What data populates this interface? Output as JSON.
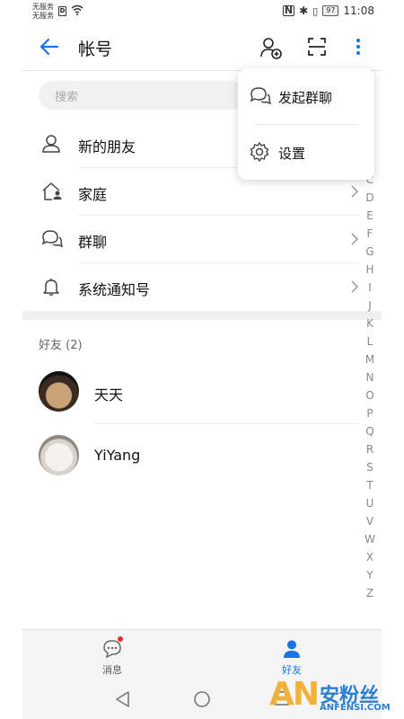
{
  "status_bar": {
    "carrier_line1": "无服务",
    "carrier_line2": "无服务",
    "battery": "97",
    "time": "11:08"
  },
  "header": {
    "title": "帐号"
  },
  "search": {
    "placeholder": "搜索"
  },
  "menu_items": [
    {
      "label": "新的朋友",
      "icon": "person-icon"
    },
    {
      "label": "家庭",
      "icon": "home-icon"
    },
    {
      "label": "群聊",
      "icon": "chat-bubbles-icon"
    },
    {
      "label": "系统通知号",
      "icon": "bell-icon"
    }
  ],
  "friends_section": {
    "title": "好友 (2)",
    "friends": [
      {
        "name": "天天"
      },
      {
        "name": "YiYang"
      }
    ]
  },
  "alphabet_index": [
    "C",
    "D",
    "E",
    "F",
    "G",
    "H",
    "I",
    "J",
    "K",
    "L",
    "M",
    "N",
    "O",
    "P",
    "Q",
    "R",
    "S",
    "T",
    "U",
    "V",
    "W",
    "X",
    "Y",
    "Z"
  ],
  "popup_menu": {
    "items": [
      {
        "label": "发起群聊",
        "icon": "chat-bubbles-icon"
      },
      {
        "label": "设置",
        "icon": "gear-icon"
      }
    ]
  },
  "tabbar": {
    "tabs": [
      {
        "label": "消息",
        "active": false
      },
      {
        "label": "好友",
        "active": true
      }
    ]
  },
  "colors": {
    "accent": "#1a73e8",
    "badge": "#e8302f"
  },
  "watermark": {
    "logo": "AN",
    "cn": "安粉丝",
    "en": "ANFENSI.COM"
  }
}
